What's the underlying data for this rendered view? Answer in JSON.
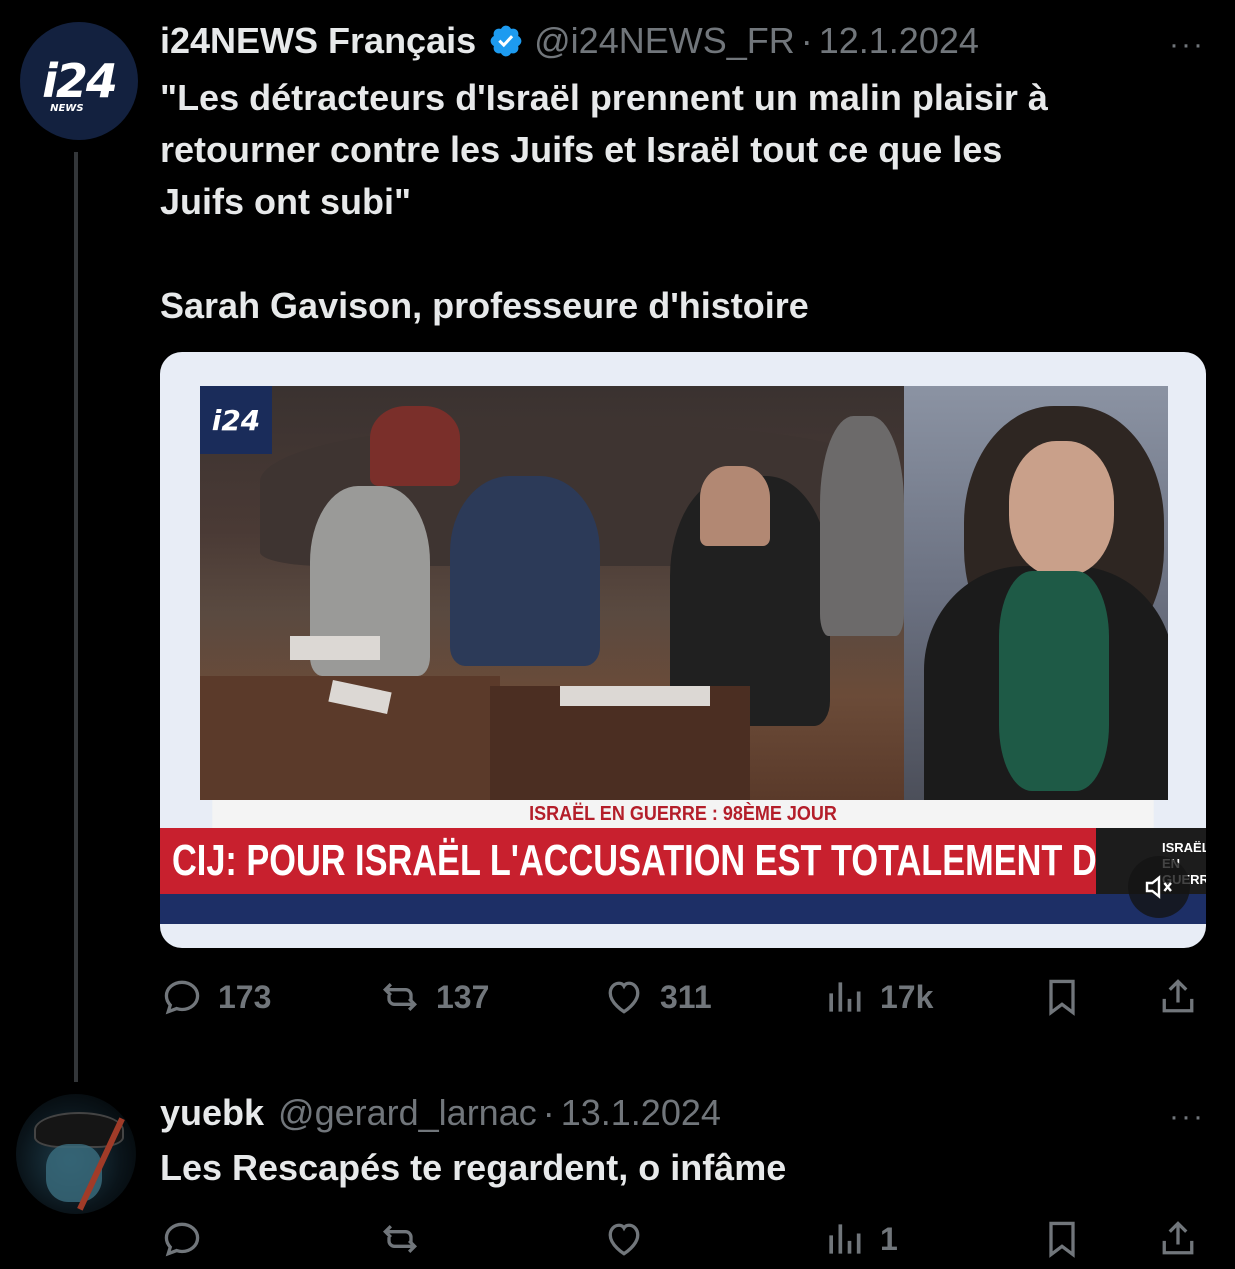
{
  "tweet": {
    "avatar_text": "i24",
    "avatar_sub": "NEWS",
    "name": "i24NEWS Français",
    "handle": "@i24NEWS_FR",
    "separator": "·",
    "date": "12.1.2024",
    "more": "···",
    "text_lines": [
      "\"Les détracteurs d'Israël prennent un malin plaisir à",
      "retourner contre les Juifs et Israël tout ce que les",
      "Juifs ont subi\"",
      "Sarah Gavison, professeure d'histoire"
    ],
    "media": {
      "tv_logo": "i24",
      "ticker_top": "ISRAËL EN GUERRE : 98ÈME JOUR",
      "ticker_main": "CIJ: POUR ISRAËL L'ACCUSATION EST TOTALEMENT DÉNATURÉE",
      "ticker_thumb": "ISRAËL EN GUERRE",
      "mute_icon": "speaker-muted-icon"
    },
    "stats": {
      "replies": "173",
      "reposts": "137",
      "likes": "311",
      "views": "17k"
    }
  },
  "reply": {
    "name": "yuebk",
    "handle": "@gerard_larnac",
    "separator": "·",
    "date": "13.1.2024",
    "more": "···",
    "text": "Les Rescapés te regardent, o infâme",
    "stats": {
      "replies": "",
      "reposts": "",
      "likes": "",
      "views": "1"
    }
  },
  "colors": {
    "background": "#000000",
    "text": "#e7e9ea",
    "muted": "#71767b",
    "verified": "#1d9bf0",
    "ticker_red": "#c8202e",
    "ticker_blue": "#1d2f66"
  }
}
